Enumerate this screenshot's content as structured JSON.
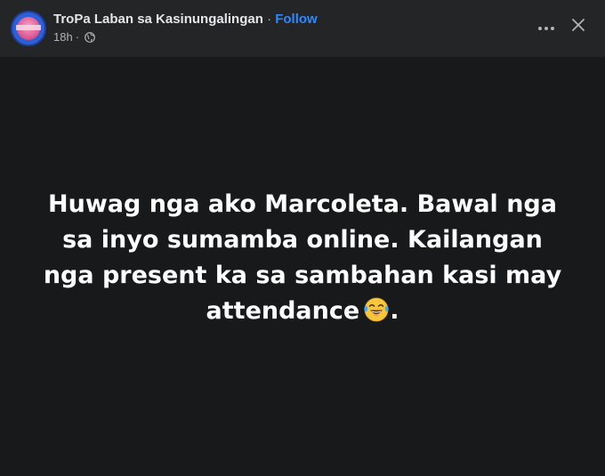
{
  "header": {
    "page_name": "TroPa Laban sa Kasinungalingan",
    "separator": "·",
    "follow_label": "Follow",
    "timestamp": "18h",
    "meta_separator": "·",
    "privacy_icon": "globe-icon",
    "more_icon": "more-horizontal-icon",
    "close_icon": "close-icon"
  },
  "post": {
    "text": "Huwag nga ako Marcoleta. Bawal nga sa inyo sumamba online. Kailangan nga present ka sa sambahan kasi may attendance",
    "emoji": "tears-of-joy-emoji",
    "trailing": ".",
    "background_color": "#18191a",
    "text_color": "#ffffff"
  },
  "colors": {
    "accent": "#2d88ff",
    "header_bg": "#242526",
    "secondary_text": "#b0b3b8"
  }
}
